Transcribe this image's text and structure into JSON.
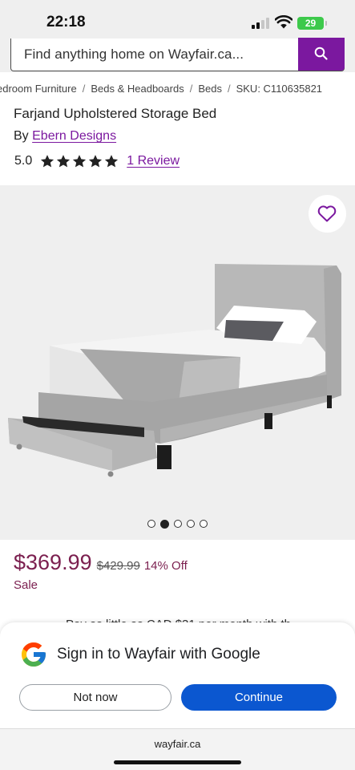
{
  "status_bar": {
    "time": "22:18",
    "battery": "29"
  },
  "search": {
    "placeholder": "Find anything home on Wayfair.ca..."
  },
  "breadcrumb": [
    "edroom Furniture",
    "Beds & Headboards",
    "Beds",
    "SKU: C110635821"
  ],
  "product": {
    "title": "Farjand Upholstered Storage Bed",
    "by_label": "By",
    "brand": "Ebern Designs",
    "rating": "5.0",
    "stars": 5,
    "reviews_label": "1 Review"
  },
  "gallery": {
    "image_count": 5,
    "active_index": 1
  },
  "pricing": {
    "price": "$369.99",
    "original_price": "$429.99",
    "discount": "14% Off",
    "sale_label": "Sale"
  },
  "partially_hidden_text": "Pay as little as CAD $31 per month with th",
  "google_prompt": {
    "title": "Sign in to Wayfair with Google",
    "not_now": "Not now",
    "continue": "Continue"
  },
  "browser": {
    "url": "wayfair.ca"
  },
  "colors": {
    "brand_purple": "#7b189f",
    "price_red": "#7b1f4f",
    "google_blue": "#0b57d0",
    "battery_green": "#3dc94b"
  }
}
